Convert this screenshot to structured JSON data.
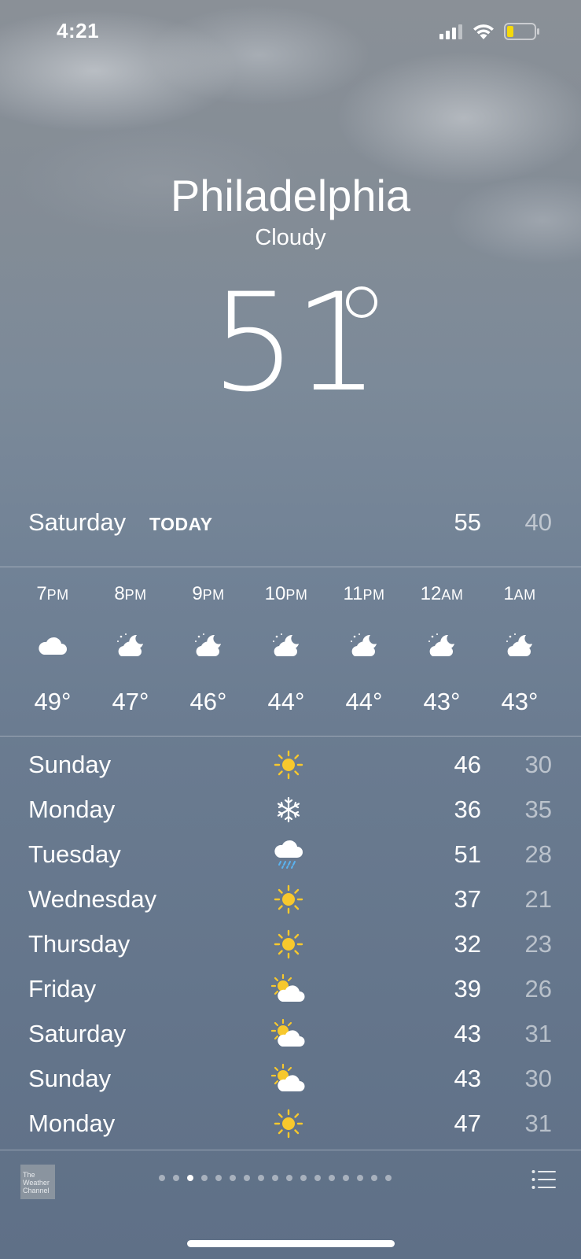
{
  "status_bar": {
    "time": "4:21",
    "icons": [
      "signal-icon",
      "wifi-icon",
      "battery-icon"
    ],
    "battery_color": "#f5d90a"
  },
  "location": {
    "city": "Philadelphia",
    "condition": "Cloudy",
    "temperature": "51"
  },
  "today": {
    "day": "Saturday",
    "label": "TODAY",
    "high": "55",
    "low": "40"
  },
  "hourly": [
    {
      "hour": "7",
      "suffix": "PM",
      "icon": "cloud-icon",
      "temp": "49°"
    },
    {
      "hour": "8",
      "suffix": "PM",
      "icon": "partly-cloudy-night-icon",
      "temp": "47°"
    },
    {
      "hour": "9",
      "suffix": "PM",
      "icon": "partly-cloudy-night-icon",
      "temp": "46°"
    },
    {
      "hour": "10",
      "suffix": "PM",
      "icon": "partly-cloudy-night-icon",
      "temp": "44°"
    },
    {
      "hour": "11",
      "suffix": "PM",
      "icon": "partly-cloudy-night-icon",
      "temp": "44°"
    },
    {
      "hour": "12",
      "suffix": "AM",
      "icon": "partly-cloudy-night-icon",
      "temp": "43°"
    },
    {
      "hour": "1",
      "suffix": "AM",
      "icon": "partly-cloudy-night-icon",
      "temp": "43°"
    }
  ],
  "daily": [
    {
      "day": "Sunday",
      "icon": "sun-icon",
      "high": "46",
      "low": "30"
    },
    {
      "day": "Monday",
      "icon": "snowflake-icon",
      "high": "36",
      "low": "35"
    },
    {
      "day": "Tuesday",
      "icon": "rain-icon",
      "high": "51",
      "low": "28"
    },
    {
      "day": "Wednesday",
      "icon": "sun-icon",
      "high": "37",
      "low": "21"
    },
    {
      "day": "Thursday",
      "icon": "sun-icon",
      "high": "32",
      "low": "23"
    },
    {
      "day": "Friday",
      "icon": "partly-sunny-icon",
      "high": "39",
      "low": "26"
    },
    {
      "day": "Saturday",
      "icon": "partly-sunny-icon",
      "high": "43",
      "low": "31"
    },
    {
      "day": "Sunday",
      "icon": "partly-sunny-icon",
      "high": "43",
      "low": "30"
    },
    {
      "day": "Monday",
      "icon": "sun-icon",
      "high": "47",
      "low": "31"
    }
  ],
  "footer": {
    "logo_text": [
      "The",
      "Weather",
      "Channel"
    ],
    "page_count": 17,
    "active_page": 3,
    "list_icon": "list-icon"
  },
  "colors": {
    "sun": "#f7c82d",
    "rain": "#5ab3f0",
    "text": "#ffffff"
  }
}
